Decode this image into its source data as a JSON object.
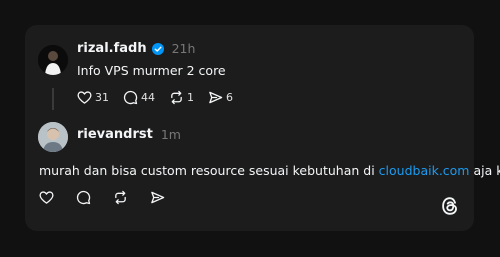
{
  "post": {
    "username": "rizal.fadh",
    "time": "21h",
    "text": "Info VPS murmer 2 core",
    "counts": {
      "likes": "31",
      "replies": "44",
      "reposts": "1",
      "shares": "6"
    }
  },
  "reply": {
    "username": "rievandrst",
    "time": "1m",
    "text_before": "murah dan bisa custom resource sesuai kebutuhan di ",
    "link": "cloudbaik.com",
    "text_after": " aja kak"
  },
  "icons": {
    "verified": "verified-badge-icon",
    "like": "heart-icon",
    "reply": "comment-icon",
    "repost": "repost-icon",
    "share": "send-icon",
    "logo": "threads-logo-icon"
  },
  "colors": {
    "background": "#111111",
    "card": "#1c1c1c",
    "link": "#1d9bf0",
    "verified": "#0095f6",
    "muted": "#777777"
  }
}
